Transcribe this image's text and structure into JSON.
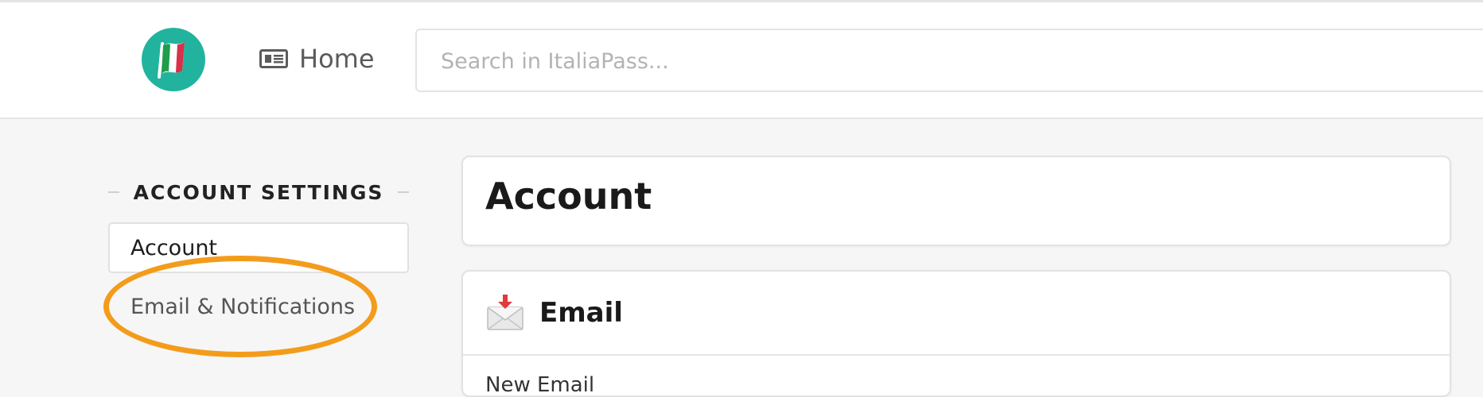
{
  "header": {
    "home_label": "Home",
    "search_placeholder": "Search in ItaliaPass..."
  },
  "sidebar": {
    "heading": "ACCOUNT SETTINGS",
    "items": [
      {
        "label": "Account",
        "active": true
      },
      {
        "label": "Email & Notifications",
        "active": false
      }
    ]
  },
  "main": {
    "account_title": "Account",
    "email_section": {
      "title": "Email",
      "field_label": "New Email"
    }
  },
  "colors": {
    "brand": "#22b39e",
    "highlight": "#f39c1b"
  },
  "icons": {
    "logo": "italy-flag-logo-icon",
    "home": "newspaper-icon",
    "email": "incoming-envelope-icon"
  }
}
